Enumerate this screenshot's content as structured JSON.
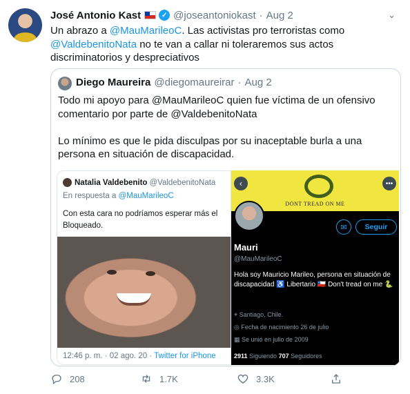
{
  "tweet": {
    "author_name": "José Antonio Kast",
    "author_handle": "@joseantoniokast",
    "dot": "·",
    "date": "Aug 2",
    "text_1": "Un abrazo a ",
    "mention_1": "@MauMarileoC",
    "text_2": ". Las activistas pro terroristas como ",
    "mention_2": "@ValdebenitoNata",
    "text_3": " no te van a callar ni toleraremos sus actos discriminatorios y despreciativos"
  },
  "quote": {
    "author_name": "Diego Maureira",
    "author_handle": "@diegomaureirar",
    "dot": "·",
    "date": "Aug 2",
    "para_1": "Todo mi apoyo para @MauMarileoC quien fue víctima de un ofensivo comentario por parte de @ValdebenitoNata",
    "para_2": "Lo mínimo es que le pida disculpas por su inaceptable burla a una persona en situación de discapacidad."
  },
  "embedded_tweet": {
    "name": "Natalia Valdebenito",
    "handle": "@ValdebenitoNata",
    "reply_prefix": "En respuesta a ",
    "reply_to": "@MauMarileoC",
    "text_line_1": "Con esta cara no podríamos esperar más el",
    "text_line_2": "Bloqueado.",
    "timestamp": "12:46 p. m. · 02 ago. 20 · ",
    "source": "Twitter for iPhone"
  },
  "profile_card": {
    "banner_text": "DONT TREAD ON ME",
    "follow_label": "Seguir",
    "name": "Mauri",
    "handle": "@MauMarileoC",
    "bio": "Hola soy Mauricio Marileo, persona en situación de discapacidad ♿ Libertario 🇨🇱 Don't tread on me 🐍",
    "location": "⌖ Santiago, Chile.",
    "birth": "◎ Fecha de nacimiento 26 de julio",
    "joined": "▦ Se unió en julio de 2009",
    "following_count": "2911",
    "following_label": " Siguiendo  ",
    "followers_count": "707",
    "followers_label": " Seguidores"
  },
  "actions": {
    "reply_count": "208",
    "retweet_count": "1.7K",
    "like_count": "3.3K"
  },
  "icons": [
    "verified-icon",
    "chevron-down-icon",
    "reply-icon",
    "retweet-icon",
    "like-icon",
    "share-icon",
    "back-arrow-icon",
    "more-icon",
    "message-icon"
  ],
  "colors": {
    "link": "#1b95e0",
    "muted": "#657786",
    "verified": "#1da1f2"
  }
}
